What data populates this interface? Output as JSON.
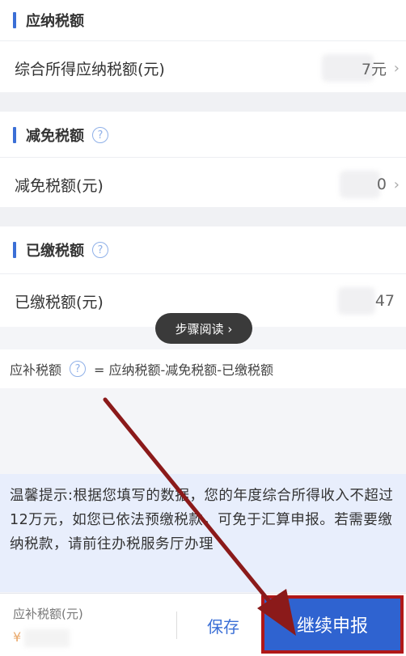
{
  "sections": {
    "payable": {
      "title": "应纳税额",
      "row_label": "综合所得应纳税额(元)",
      "row_value": "7元"
    },
    "reduction": {
      "title": "减免税额",
      "row_label": "减免税额(元)",
      "row_value": "0"
    },
    "paid": {
      "title": "已缴税额",
      "row_label": "已缴税额(元)",
      "row_value": "47"
    }
  },
  "toast": "步骤阅读 ›",
  "formula": {
    "label": "应补税额",
    "expression": "= 应纳税额-减免税额-已缴税额"
  },
  "tip": "温馨提示:根据您填写的数据，您的年度综合所得收入不超过12万元，如您已依法预缴税款，可免于汇算申报。若需要缴纳税款，请前往办税服务厅办理",
  "footer": {
    "amount_label": "应补税额(元)",
    "amount_value": "¥",
    "save_label": "保存",
    "submit_label": "继续申报"
  },
  "icons": {
    "help": "help-circle-icon",
    "chevron": "chevron-right-icon"
  },
  "colors": {
    "accent": "#3b6fd6",
    "tip_bg": "#e8eefc",
    "annotation": "#8b1a1a"
  }
}
